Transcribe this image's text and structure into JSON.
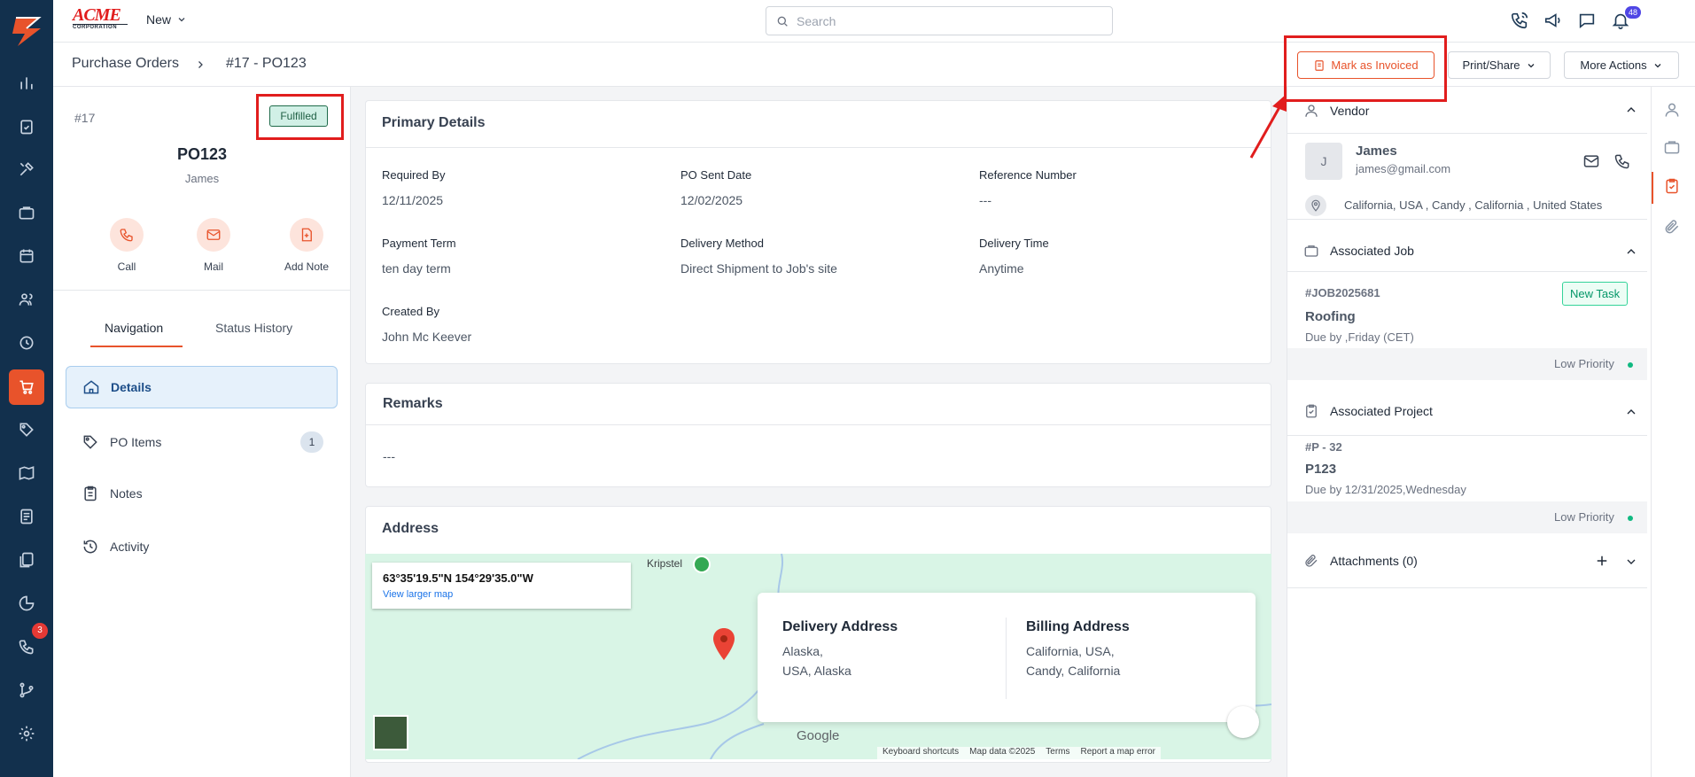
{
  "topbar": {
    "brand_name": "ACME",
    "brand_sub": "CORPORATION",
    "new_label": "New",
    "search_placeholder": "Search",
    "notification_count": "48"
  },
  "sidebar": {
    "calls_badge": "3"
  },
  "breadcrumb": {
    "root": "Purchase Orders",
    "current": "#17 - PO123"
  },
  "actions": {
    "mark_invoiced": "Mark as Invoiced",
    "print_share": "Print/Share",
    "more_actions": "More Actions"
  },
  "summary": {
    "number": "#17",
    "status": "Fulfilled",
    "po_name": "PO123",
    "vendor": "James",
    "quick_actions": [
      "Call",
      "Mail",
      "Add Note"
    ]
  },
  "tabs": {
    "navigation": "Navigation",
    "status_history": "Status History"
  },
  "nav": {
    "details": "Details",
    "po_items": "PO Items",
    "po_items_count": "1",
    "notes": "Notes",
    "activity": "Activity"
  },
  "primary": {
    "title": "Primary Details",
    "required_by_label": "Required By",
    "required_by": "12/11/2025",
    "po_sent_label": "PO Sent Date",
    "po_sent": "12/02/2025",
    "ref_label": "Reference Number",
    "ref": "---",
    "payment_term_label": "Payment Term",
    "payment_term": "ten day term",
    "delivery_method_label": "Delivery Method",
    "delivery_method": "Direct Shipment to Job's site",
    "delivery_time_label": "Delivery Time",
    "delivery_time": "Anytime",
    "created_by_label": "Created By",
    "created_by": "John Mc Keever"
  },
  "remarks": {
    "title": "Remarks",
    "value": "---"
  },
  "address": {
    "title": "Address",
    "coords": "63°35'19.5\"N 154°29'35.0\"W",
    "view_larger": "View larger map",
    "place_label": "Kripstel",
    "delivery_title": "Delivery Address",
    "delivery_line1": "Alaska,",
    "delivery_line2": "USA, Alaska",
    "billing_title": "Billing Address",
    "billing_line1": "California, USA,",
    "billing_line2": "Candy, California",
    "google": "Google",
    "footer": [
      "Keyboard shortcuts",
      "Map data ©2025",
      "Terms",
      "Report a map error"
    ]
  },
  "vendor": {
    "title": "Vendor",
    "initial": "J",
    "name": "James",
    "email": "james@gmail.com",
    "location": "California, USA , Candy , California , United States"
  },
  "job": {
    "title": "Associated Job",
    "number": "#JOB2025681",
    "status": "New Task",
    "name": "Roofing",
    "due": "Due by ,Friday (CET)",
    "priority": "Low Priority"
  },
  "project": {
    "title": "Associated Project",
    "number": "#P - 32",
    "name": "P123",
    "due": "Due by 12/31/2025,Wednesday",
    "priority": "Low Priority"
  },
  "attachments": {
    "title": "Attachments (0)"
  },
  "colors": {
    "accent": "#e8532b",
    "nav_bg": "#12304d",
    "priority_dot": "#10b981",
    "annotation_red": "#e11d1d"
  }
}
